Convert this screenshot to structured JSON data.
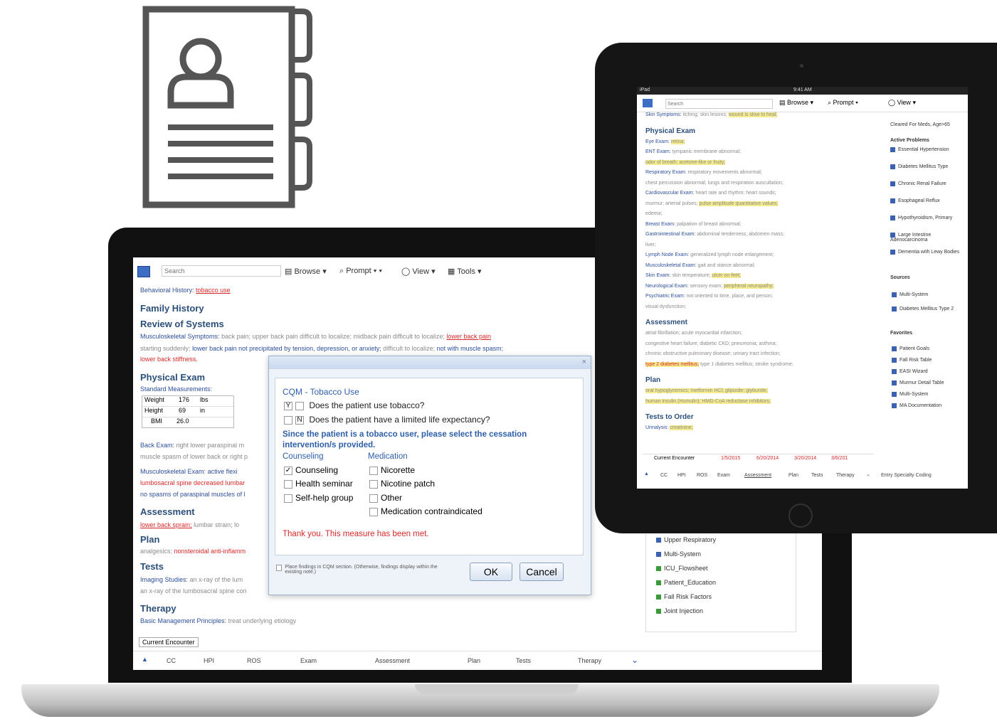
{
  "laptop": {
    "toolbar": {
      "search_placeholder": "Search",
      "browse": "Browse",
      "prompt": "Prompt",
      "view": "View",
      "tools": "Tools"
    },
    "note": {
      "behavioral_label": "Behavioral History:",
      "behavioral_value": "tobacco use",
      "family_history": "Family History",
      "review_of_systems": "Review of Systems",
      "msk_symptoms_label": "Musculoskeletal Symptoms:",
      "msk_symptoms_1": "back pain; upper back pain difficult to localize; midback pain difficult to localize;",
      "msk_symptoms_red": "lower back pain",
      "msk_line2": "starting suddenly;",
      "msk_line2_link": "lower back pain not precipitated by tension, depression, or anxiety;",
      "msk_line2_gray": "difficult to localize;",
      "msk_line2_link2": "not with muscle spasm;",
      "msk_line3": "lower back stiffness.",
      "physical_exam": "Physical Exam",
      "standard_measurements": "Standard Measurements:",
      "vitals": [
        {
          "label": "Weight",
          "value": "176",
          "unit": "lbs"
        },
        {
          "label": "Height",
          "value": "69",
          "unit": "in"
        },
        {
          "label": "BMI",
          "value": "26.0",
          "unit": ""
        }
      ],
      "back_exam": "Back Exam:",
      "back_exam_text": "right lower paraspinal m",
      "back_exam_line2": "muscle spasm of lower back or right p",
      "msk_exam": "Musculoskeletal Exam:",
      "msk_exam_text": "active flexi",
      "msk_exam_red": "lumbosacral spine decreased lumbar",
      "msk_exam_line3": "no spasms of paraspinal muscles of l",
      "assessment": "Assessment",
      "assessment_red": "lower back sprain;",
      "assessment_gray": "lumbar strain; lo",
      "plan": "Plan",
      "plan_gray": "analgesics;",
      "plan_red": "nonsteroidal anti-inflamm",
      "tests": "Tests",
      "imaging": "Imaging Studies:",
      "imaging_text": "an x-ray of the lum",
      "imaging_line2": "an x-ray of the lumbosacral spine con",
      "therapy": "Therapy",
      "basic_mgmt": "Basic Management Principles:",
      "basic_mgmt_text": "treat underlying etiology"
    },
    "dialog": {
      "title": "CQM - Tobacco Use",
      "q1_box": "Y",
      "q1": "Does the patient use tobacco?",
      "q2_box": "N",
      "q2": "Does the patient have a limited life expectancy?",
      "instruction": "Since the patient is a tobacco user, please select the cessation intervention/s provided.",
      "counseling_h": "Counseling",
      "medication_h": "Medication",
      "counseling": [
        {
          "label": "Counseling",
          "checked": true
        },
        {
          "label": "Health seminar",
          "checked": false
        },
        {
          "label": "Self-help group",
          "checked": false
        }
      ],
      "medication": [
        {
          "label": "Nicorette",
          "checked": false
        },
        {
          "label": "Nicotine patch",
          "checked": false
        },
        {
          "label": "Other",
          "checked": false
        },
        {
          "label": "Medication contraindicated",
          "checked": false
        }
      ],
      "met_message": "Thank you. This measure has been met.",
      "footer_note": "Place findings in CQM section. (Otherwise, findings display within the existing note.)",
      "ok": "OK",
      "cancel": "Cancel"
    },
    "current_encounter": "Current Encounter",
    "tabs": [
      "CC",
      "HPI",
      "ROS",
      "Exam",
      "Assessment",
      "Plan",
      "Tests",
      "Therapy"
    ],
    "right_panel": [
      "Upper Respiratory",
      "Multi-System",
      "ICU_Flowsheet",
      "Patient_Education",
      "Fall Risk Factors",
      "Joint Injection"
    ]
  },
  "tablet": {
    "status": {
      "left": "iPad",
      "time": "9:41 AM"
    },
    "toolbar": {
      "search_placeholder": "Search",
      "browse": "Browse",
      "prompt": "Prompt",
      "view": "View"
    },
    "note_lines": [
      {
        "label": "Skin Symptoms:",
        "text": "itching; skin lesions;",
        "hl": "wound is slow to heal;"
      },
      {
        "header": "Physical Exam"
      },
      {
        "label": "Eye Exam:",
        "text": "",
        "hl": "retina;"
      },
      {
        "label": "ENT Exam:",
        "text": "tympanic membrane abnormal;"
      },
      {
        "text": "",
        "hl": "odor of breath: acetone-like or fruity;"
      },
      {
        "label": "Respiratory Exam:",
        "text": "respiratory movements abnormal;"
      },
      {
        "text": "chest percussion abnormal; lungs and respiration auscultation;"
      },
      {
        "label": "Cardiovascular Exam:",
        "text": "heart rate and rhythm; heart sounds;"
      },
      {
        "text": "murmur; arterial pulses;",
        "hl": "pulse amplitude quantitative values;"
      },
      {
        "text": "edema;"
      },
      {
        "label": "Breast Exam:",
        "text": "palpation of breast abnormal;"
      },
      {
        "label": "Gastrointestinal Exam:",
        "text": "abdominal tenderness; abdomen mass;"
      },
      {
        "text": "liver;"
      },
      {
        "label": "Lymph Node Exam:",
        "text": "generalized lymph node enlargement;"
      },
      {
        "label": "Musculoskeletal Exam:",
        "text": "gait and stance abnormal;"
      },
      {
        "label": "Skin Exam:",
        "text": "skin temperature;",
        "hl": "ulcer on feet;"
      },
      {
        "label": "Neurological Exam:",
        "text": "sensory exam;",
        "hl": "peripheral neuropathy;"
      },
      {
        "label": "Psychiatric Exam:",
        "text": "not oriented to time, place, and person;"
      },
      {
        "text": "visual dysfunction;"
      },
      {
        "header": "Assessment"
      },
      {
        "text": "atrial fibrillation; acute myocardial infarction;"
      },
      {
        "text": "congestive heart failure; diabetic CKD; pneumonia; asthma;"
      },
      {
        "text": "chronic obstructive pulmonary disease; urinary tract infection;"
      },
      {
        "hlr": "type 2 diabetes mellitus;",
        "text": "type 1 diabetes mellitus; stroke syndrome;"
      },
      {
        "header": "Plan"
      },
      {
        "hl": "oral hypoglycemics; metformin HCl; glipizide; glyburide;"
      },
      {
        "hl": "human insulin (Humulin); HMG-CoA reductase inhibitors;"
      },
      {
        "header": "Tests to Order"
      },
      {
        "label": "Urinalysis:",
        "hl": "creatinine;"
      }
    ],
    "encounter_bar": {
      "label": "Current Encounter",
      "dates": [
        "1/5/2015",
        "6/20/2014",
        "3/20/2014",
        "3/6/201"
      ]
    },
    "tabs": [
      "CC",
      "HPI",
      "ROS",
      "Exam",
      "Assessment",
      "Plan",
      "Tests",
      "Therapy"
    ],
    "specialty": "Entry Specialty Coding",
    "sidebar": {
      "top": "Cleared For Meds, Age>65",
      "active_problems_h": "Active Problems",
      "active_problems": [
        "Essential Hypertension",
        "Diabetes Mellitus Type",
        "Chronic Renal Failure",
        "Esophageal Reflux",
        "Hypothyroidism, Primary",
        "Large Intestine Adenocarcinoma",
        "Dementia with Lewy Bodies"
      ],
      "sources_h": "Sources",
      "sources": [
        "Multi-System",
        "Diabetes Mellitus Type 2"
      ],
      "favorites_h": "Favorites",
      "favorites": [
        "Patient Goals",
        "Fall Risk Table",
        "EASI Wizard",
        "Murmur Detail Table",
        "Multi-System",
        "MA Documentation"
      ]
    }
  }
}
